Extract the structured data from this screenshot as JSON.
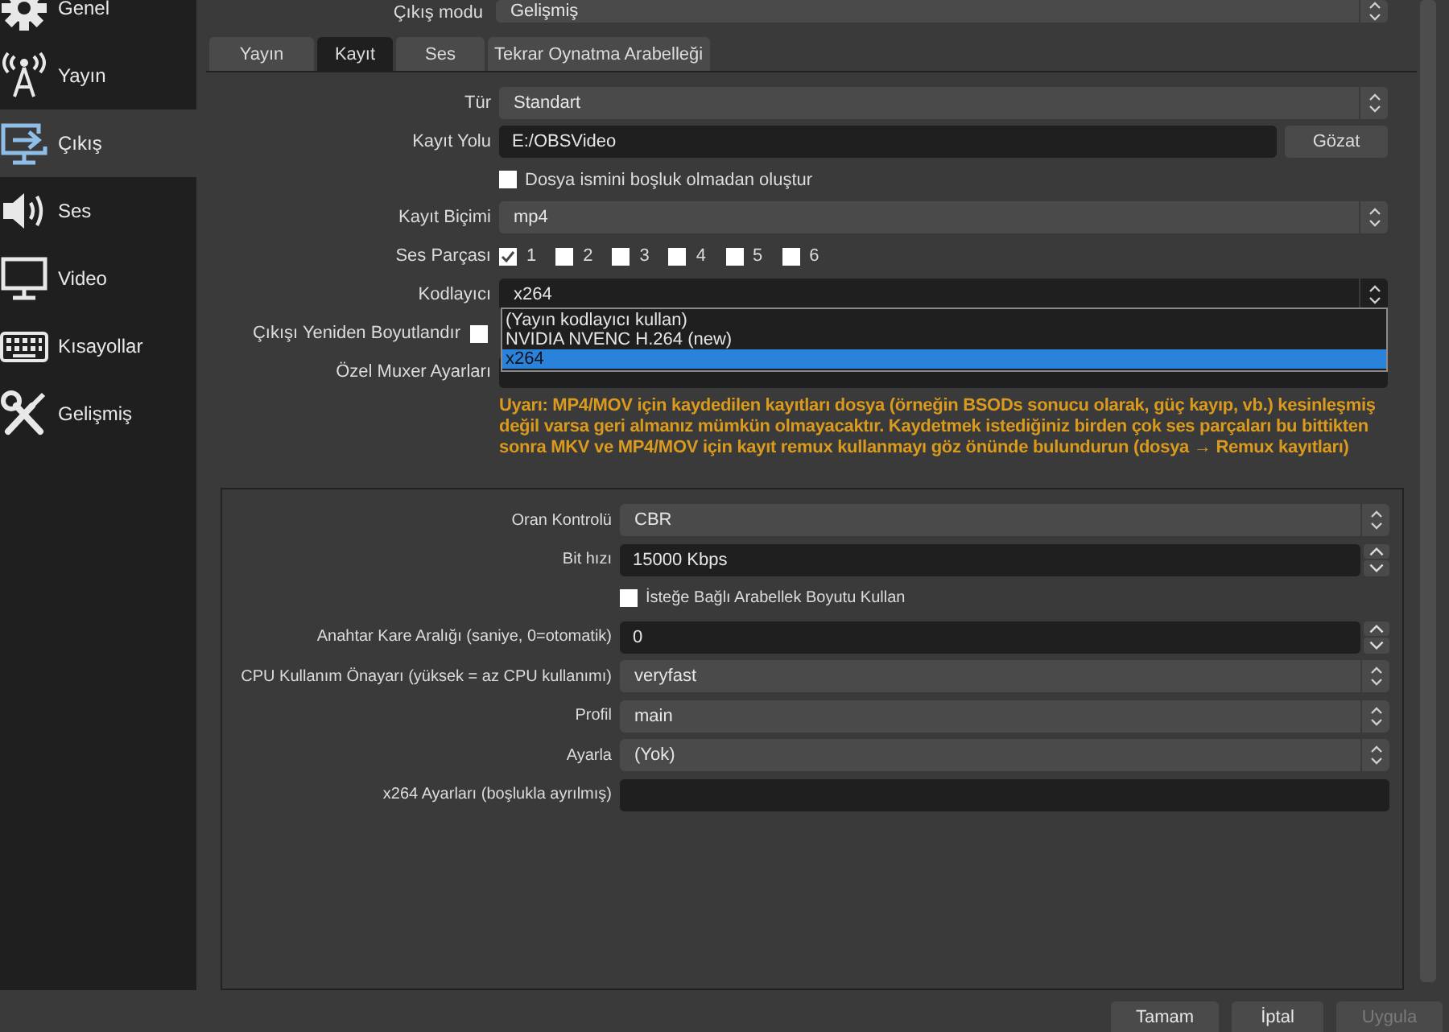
{
  "top_row": {
    "label": "Çıkış modu",
    "value": "Gelişmiş"
  },
  "sidebar": {
    "items": [
      {
        "label": "Genel",
        "selected": false
      },
      {
        "label": "Yayın",
        "selected": false
      },
      {
        "label": "Çıkış",
        "selected": true
      },
      {
        "label": "Ses",
        "selected": false
      },
      {
        "label": "Video",
        "selected": false
      },
      {
        "label": "Kısayollar",
        "selected": false
      },
      {
        "label": "Gelişmiş",
        "selected": false
      }
    ]
  },
  "tabs": [
    {
      "label": "Yayın",
      "selected": false
    },
    {
      "label": "Kayıt",
      "selected": true
    },
    {
      "label": "Ses",
      "selected": false
    },
    {
      "label": "Tekrar Oynatma Arabelleği",
      "selected": false
    }
  ],
  "recording": {
    "type": {
      "label": "Tür",
      "value": "Standart"
    },
    "path": {
      "label": "Kayıt Yolu",
      "value": "E:/OBSVideo",
      "button": "Gözat"
    },
    "no_space": {
      "label": "Dosya ismini boşluk olmadan oluştur",
      "checked": false
    },
    "format": {
      "label": "Kayıt Biçimi",
      "value": "mp4"
    },
    "audio_tracks": {
      "label": "Ses Parçası",
      "tracks": [
        {
          "label": "1",
          "checked": true
        },
        {
          "label": "2",
          "checked": false
        },
        {
          "label": "3",
          "checked": false
        },
        {
          "label": "4",
          "checked": false
        },
        {
          "label": "5",
          "checked": false
        },
        {
          "label": "6",
          "checked": false
        }
      ]
    },
    "encoder": {
      "label": "Kodlayıcı",
      "value": "x264",
      "expanded": true,
      "options": [
        {
          "label": "(Yayın kodlayıcı kullan)",
          "selected": false
        },
        {
          "label": "NVIDIA NVENC H.264 (new)",
          "selected": false
        },
        {
          "label": "x264",
          "selected": true
        }
      ]
    },
    "rescale": {
      "label": "Çıkışı Yeniden Boyutlandır",
      "checked": false
    },
    "muxer": {
      "label": "Özel Muxer Ayarları"
    },
    "warning": "Uyarı: MP4/MOV için kaydedilen kayıtları dosya (örneğin BSODs sonucu olarak, güç kayıp, vb.) kesinleşmiş değil varsa geri almanız mümkün olmayacaktır. Kaydetmek istediğiniz birden çok ses parçaları bu bittikten sonra MKV ve MP4/MOV için kayıt remux kullanmayı göz önünde bulundurun (dosya → Remux kayıtları)"
  },
  "encoder_settings": {
    "rows": [
      {
        "kind": "combo",
        "label": "Oran Kontrolü",
        "value": "CBR"
      },
      {
        "kind": "spin",
        "label": "Bit hızı",
        "value": "15000 Kbps"
      },
      {
        "kind": "checkbox",
        "label": "İsteğe Bağlı Arabellek Boyutu Kullan",
        "checked": false
      },
      {
        "kind": "spin",
        "label": "Anahtar Kare Aralığı (saniye, 0=otomatik)",
        "value": "0"
      },
      {
        "kind": "combo",
        "label": "CPU Kullanım Önayarı (yüksek = az CPU kullanımı)",
        "value": "veryfast"
      },
      {
        "kind": "combo",
        "label": "Profil",
        "value": "main"
      },
      {
        "kind": "combo",
        "label": "Ayarla",
        "value": "(Yok)"
      },
      {
        "kind": "field",
        "label": "x264 Ayarları (boşlukla ayrılmış)"
      }
    ]
  },
  "buttons": [
    {
      "label": "Tamam",
      "disabled": false
    },
    {
      "label": "İptal",
      "disabled": false
    },
    {
      "label": "Uygula",
      "disabled": true
    }
  ]
}
